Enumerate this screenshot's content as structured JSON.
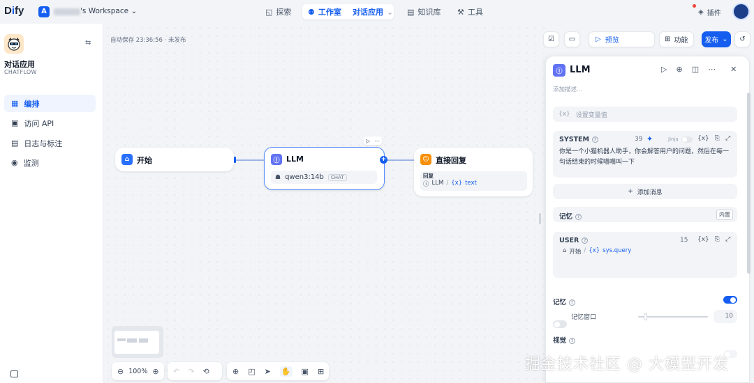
{
  "header": {
    "logo_text": "Dify",
    "workspace_initial": "A",
    "workspace_name": "'s Workspace",
    "nav": {
      "explore": "探索",
      "studio": "工作室",
      "app_selector": "对话应用",
      "knowledge": "知识库",
      "tools": "工具"
    },
    "plugins": "插件"
  },
  "sidebar": {
    "app_name": "对话应用",
    "app_type": "CHATFLOW",
    "items": [
      {
        "label": "编排",
        "icon": "layout-icon",
        "active": true
      },
      {
        "label": "访问 API",
        "icon": "terminal-icon",
        "active": false
      },
      {
        "label": "日志与标注",
        "icon": "document-icon",
        "active": false
      },
      {
        "label": "监测",
        "icon": "monitor-icon",
        "active": false
      }
    ]
  },
  "canvas": {
    "autosave": "自动保存 23:36:56 · 未发布",
    "toolbar": {
      "preview": "预览",
      "features": "功能",
      "publish": "发布"
    },
    "nodes": {
      "start": {
        "title": "开始"
      },
      "llm": {
        "title": "LLM",
        "model": "qwen3:14b",
        "model_tag": "CHAT"
      },
      "answer": {
        "title": "直接回复",
        "section": "回复",
        "var_node": "LLM",
        "var_name": "text",
        "var_prefix": "{x}"
      }
    },
    "zoom": "100%"
  },
  "panel": {
    "title": "LLM",
    "description_placeholder": "添加描述...",
    "context_placeholder": "设置变量值",
    "system": {
      "label": "SYSTEM",
      "count": "39",
      "jinja": "Jinja",
      "text": "你是一个小猫机器人助手，你会解答用户的问题，然后在每一句话结束的时候喵喵叫一下"
    },
    "add_message": "添加消息",
    "memory_row": {
      "label": "记忆",
      "tag": "内置"
    },
    "user": {
      "label": "USER",
      "count": "15",
      "var_node": "开始",
      "var_name": "sys.query"
    },
    "memory": {
      "label": "记忆",
      "enabled": true
    },
    "memory_window": {
      "label": "记忆窗口",
      "value": "10",
      "enabled": false
    },
    "vision": {
      "label": "视觉",
      "enabled": false
    }
  },
  "watermark": "掘金技术社区 @ 大模型开发",
  "colors": {
    "accent": "#155eef",
    "start_icon": "#2970ff",
    "llm_icon": "#6172f3",
    "answer_icon": "#f79009"
  }
}
